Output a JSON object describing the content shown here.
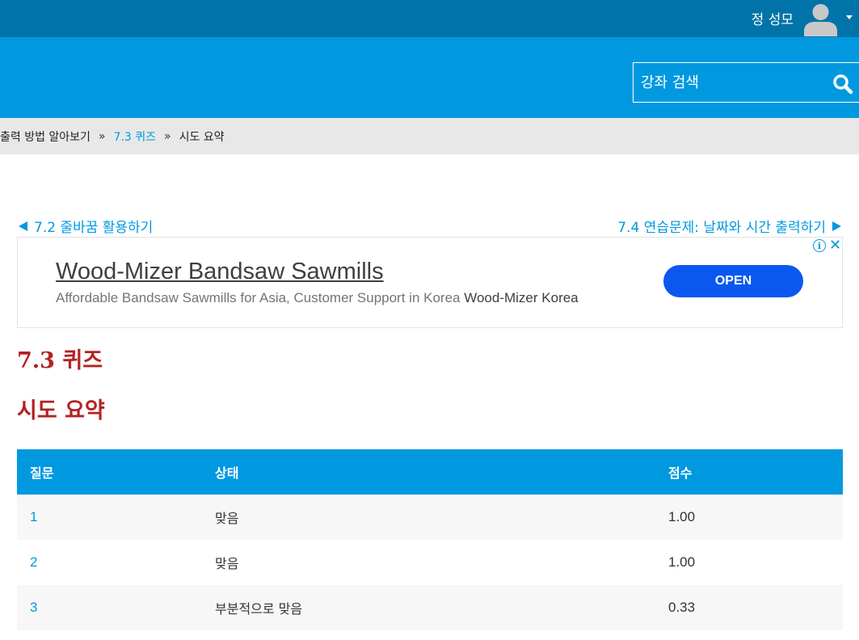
{
  "topbar": {
    "user_name": "정 성모",
    "avatar_icon": "user-avatar-icon",
    "menu_icon": "caret-down-icon"
  },
  "header": {
    "search": {
      "placeholder": "강좌 검색",
      "icon": "search-icon"
    }
  },
  "breadcrumb": {
    "items": [
      "출력 방법 알아보기",
      "7.3 퀴즈",
      "시도 요약"
    ],
    "separator": "»"
  },
  "nav": {
    "prev_label": "7.2 줄바꿈 활용하기",
    "next_label": "7.4 연습문제: 날짜와 시간 출력하기"
  },
  "ad": {
    "title": "Wood-Mizer Bandsaw Sawmills",
    "description": "Affordable Bandsaw Sawmills for Asia, Customer Support in Korea",
    "advertiser": "Wood-Mizer Korea",
    "open_label": "OPEN",
    "info_icon": "info-icon",
    "close_icon": "close-icon"
  },
  "page": {
    "quiz_title": "7.3 퀴즈",
    "summary_title": "시도 요약"
  },
  "table": {
    "headers": [
      "질문",
      "상태",
      "점수"
    ],
    "rows": [
      {
        "question": "1",
        "status": "맞음",
        "score": "1.00"
      },
      {
        "question": "2",
        "status": "맞음",
        "score": "1.00"
      },
      {
        "question": "3",
        "status": "부분적으로 맞음",
        "score": "0.33"
      }
    ]
  },
  "colors": {
    "topbar": "#0074a8",
    "header": "#0099e0",
    "accent": "#0099e0",
    "heading": "#b22222",
    "ad_button": "#0b57f0"
  }
}
